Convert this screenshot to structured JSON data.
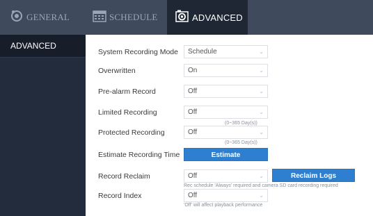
{
  "tabs": [
    {
      "label": "GENERAL",
      "icon": "general-settings-icon"
    },
    {
      "label": "SCHEDULE",
      "icon": "calendar-icon"
    },
    {
      "label": "ADVANCED",
      "icon": "advanced-settings-icon",
      "active": true
    }
  ],
  "sidebar": {
    "items": [
      {
        "label": "ADVANCED",
        "active": true
      }
    ]
  },
  "form": {
    "system_recording_mode": {
      "label": "System Recording Mode",
      "value": "Schedule"
    },
    "overwritten": {
      "label": "Overwritten",
      "value": "On"
    },
    "pre_alarm_record": {
      "label": "Pre-alarm Record",
      "value": "Off"
    },
    "limited_recording": {
      "label": "Limited Recording",
      "value": "Off",
      "hint": "(0~365 Day(s))"
    },
    "protected_recording": {
      "label": "Protected Recording",
      "value": "Off",
      "hint": "(0~365 Day(s))"
    },
    "estimate_recording_time": {
      "label": "Estimate Recording Time",
      "button": "Estimate"
    },
    "record_reclaim": {
      "label": "Record Reclaim",
      "value": "Off",
      "button": "Reclaim Logs",
      "hint": "Rec schedule 'Always' required and camera SD card recording required"
    },
    "record_index": {
      "label": "Record Index",
      "value": "Off",
      "hint": "'Off' will affect playback performance"
    }
  },
  "colors": {
    "topbar": "#3f4a5c",
    "active_tab": "#1f2735",
    "sidebar": "#232c3c",
    "sidebar_active": "#171d29",
    "button": "#2f7fd0"
  }
}
